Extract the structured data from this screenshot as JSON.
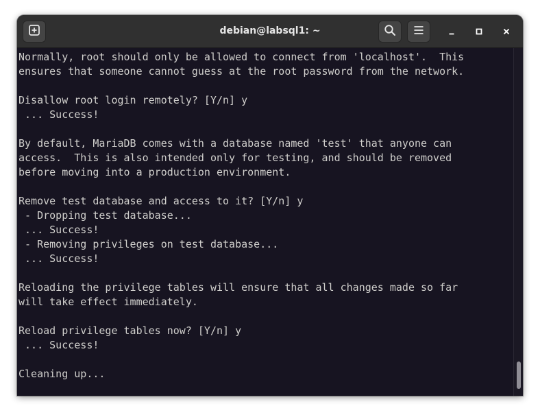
{
  "window": {
    "title": "debian@labsql1: ~"
  },
  "header": {
    "new_tab_icon": "new-tab-icon",
    "search_icon": "search-icon",
    "menu_icon": "hamburger-menu-icon",
    "minimize_icon": "minimize-icon",
    "maximize_icon": "maximize-icon",
    "close_icon": "close-icon"
  },
  "terminal": {
    "background": "#171421",
    "foreground": "#d0cfcc",
    "lines": [
      "Normally, root should only be allowed to connect from 'localhost'.  This",
      "ensures that someone cannot guess at the root password from the network.",
      "",
      "Disallow root login remotely? [Y/n] y",
      " ... Success!",
      "",
      "By default, MariaDB comes with a database named 'test' that anyone can",
      "access.  This is also intended only for testing, and should be removed",
      "before moving into a production environment.",
      "",
      "Remove test database and access to it? [Y/n] y",
      " - Dropping test database...",
      " ... Success!",
      " - Removing privileges on test database...",
      " ... Success!",
      "",
      "Reloading the privilege tables will ensure that all changes made so far",
      "will take effect immediately.",
      "",
      "Reload privilege tables now? [Y/n] y",
      " ... Success!",
      "",
      "Cleaning up..."
    ]
  },
  "scrollbar": {
    "position": 1.0
  }
}
